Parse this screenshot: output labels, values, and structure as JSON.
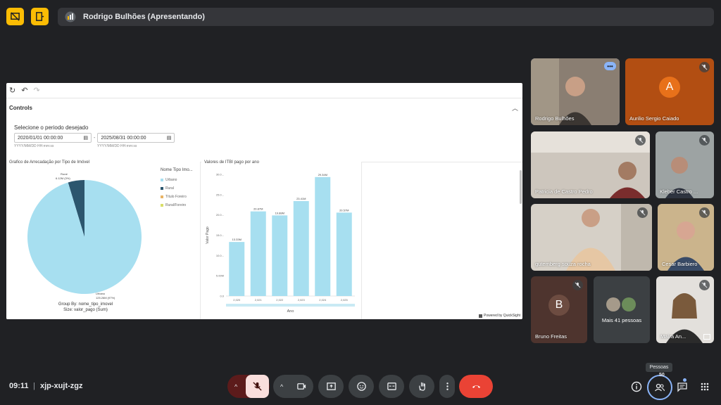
{
  "top": {
    "presenter": "Rodrigo Bulhões (Apresentando)",
    "left_icons": [
      "present-to-all-off-icon",
      "exit-door-icon"
    ]
  },
  "shared_screen": {
    "toolbar": {
      "redo": "↻",
      "undo": "↶",
      "forward": "↷"
    },
    "controls_title": "Controls",
    "period_label": "Selecione o periodo desejado",
    "start_date": "2020/01/01 00:00:00",
    "end_date": "2025/08/31 00:00:00",
    "date_separator": "-",
    "date_hint": "YYYY/MM/DD HH:mm:ss",
    "powered_by": "Powered by QuickSight",
    "pie_visual": {
      "title": "Grafico de Arrecadação por Tipo de Imóvel",
      "legend_title": "Nome Tipo Imo...",
      "legend_items": [
        {
          "label": "Urbano",
          "color": "#a7dff0"
        },
        {
          "label": "Rural",
          "color": "#2c566e"
        },
        {
          "label": "Título Foreiro",
          "color": "#e8b466"
        },
        {
          "label": "Rural/Foreiro",
          "color": "#d8de6a"
        }
      ],
      "callout_rural": "Rural",
      "callout_rural_value": "6.12M (3%)",
      "callout_urbano": "Urbano",
      "callout_urbano_value": "125.26M (97%)",
      "group_by": "Group By: nome_tipo_imovel",
      "size": "Size: valor_pago (Sum)"
    },
    "bar_visual": {
      "title": "Valores de ITBI pago por ano",
      "ylabel": "Valor Pago",
      "xlabel": "Ano"
    }
  },
  "chart_data": [
    {
      "type": "pie",
      "categories": [
        "Urbano",
        "Rural"
      ],
      "values": [
        125.26,
        6.12
      ],
      "unit": "M",
      "percent_labels": [
        "97%",
        "3%"
      ]
    },
    {
      "type": "bar",
      "categories": [
        "2,020",
        "2,021",
        "2,022",
        "2,023",
        "2,024",
        "2,025"
      ],
      "values": [
        13.33,
        20.87,
        19.88,
        23.41,
        29.34,
        20.57
      ],
      "labels": [
        "13.33M",
        "20.87M",
        "19.88M",
        "23.41M",
        "29.34M",
        "20.57M"
      ],
      "yticks": [
        "0.0",
        "5.00M",
        "10.0...",
        "15.0...",
        "20.0...",
        "25.0...",
        "30.0..."
      ],
      "ylim": [
        0,
        30
      ],
      "bar_color": "#a7dff0"
    }
  ],
  "participants": [
    {
      "name": "Rodrigo Bulhões",
      "active": true
    },
    {
      "name": "Aurilio Sergio Caiado",
      "initial": "A",
      "color": "#e8711a"
    },
    {
      "name": "Patricia de Castro Pedro"
    },
    {
      "name": "Kleber Castro ..."
    },
    {
      "name": "gutemberg souza rocha"
    },
    {
      "name": "Cesar Barbiero"
    },
    {
      "name": "Bruno Freitas",
      "initial": "B",
      "color": "#6d4c41"
    },
    {
      "name": "Mais 41 pessoas"
    },
    {
      "name": "Maíra An..."
    }
  ],
  "bottom": {
    "time": "09:11",
    "separator": "|",
    "meeting_code": "xjp-xujt-zgz",
    "tooltip": "Pessoas",
    "people_count": "50"
  }
}
